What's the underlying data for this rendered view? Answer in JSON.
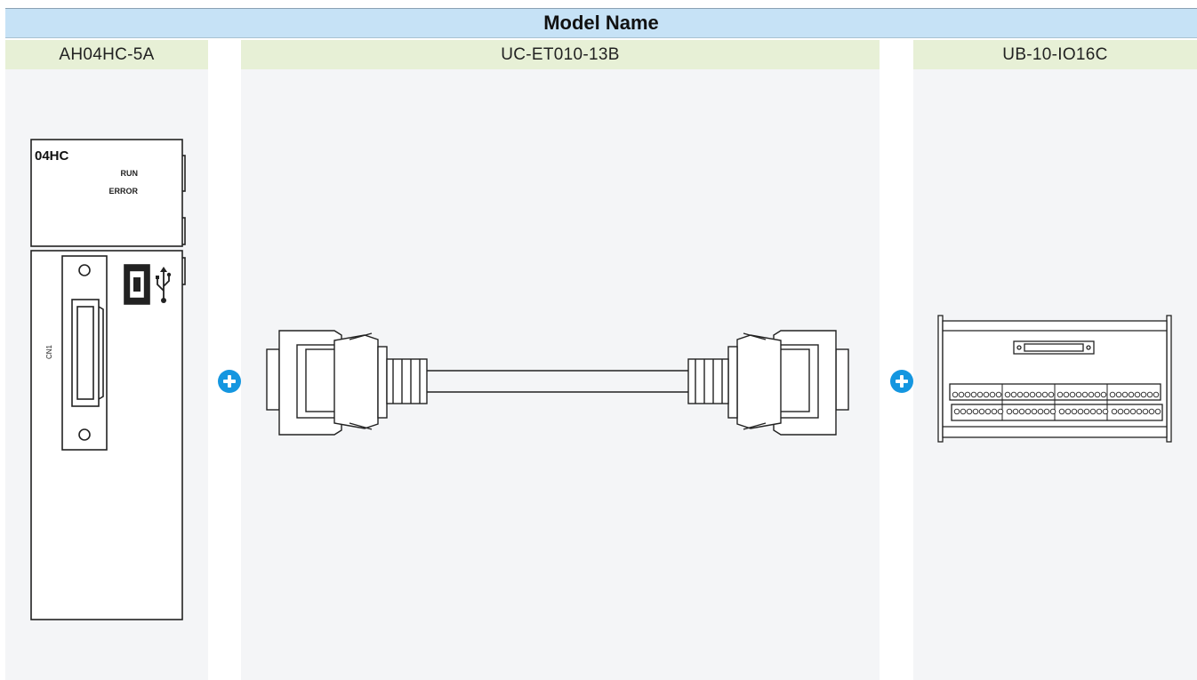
{
  "header": {
    "title": "Model Name"
  },
  "columns": [
    {
      "model": "AH04HC-5A"
    },
    {
      "model": "UC-ET010-13B"
    },
    {
      "model": "UB-10-IO16C"
    }
  ],
  "module": {
    "label": "04HC",
    "led_run": "RUN",
    "led_error": "ERROR",
    "connector_label": "CN1",
    "usb_symbol": "usb-icon"
  },
  "colors": {
    "header_bg": "#c6e2f6",
    "column_header_bg": "#e7f0d6",
    "panel_bg": "#f4f5f7",
    "plus_icon": "#1496e0"
  }
}
